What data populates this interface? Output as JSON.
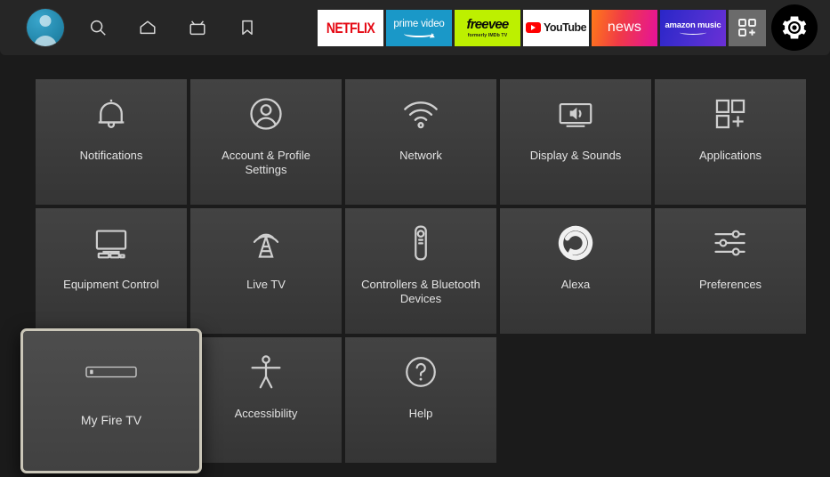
{
  "topbar": {
    "nav": [
      {
        "name": "profile-avatar",
        "icon": "avatar-icon",
        "label": "Profile"
      },
      {
        "name": "search",
        "icon": "search-icon",
        "label": "Search"
      },
      {
        "name": "home",
        "icon": "home-icon",
        "label": "Home"
      },
      {
        "name": "live-tv",
        "icon": "tv-icon",
        "label": "Live TV"
      },
      {
        "name": "watchlist",
        "icon": "bookmark-icon",
        "label": "Watchlist"
      }
    ],
    "apps": [
      {
        "id": "netflix",
        "label": "NETFLIX",
        "sub": "",
        "bg": "#ffffff",
        "fg": "#e50914"
      },
      {
        "id": "prime-video",
        "label": "prime video",
        "sub": "",
        "bg": "#1a98c8",
        "fg": "#ffffff"
      },
      {
        "id": "freevee",
        "label": "freevee",
        "sub": "formerly IMDb TV",
        "bg": "#bdf000",
        "fg": "#0a0a0a"
      },
      {
        "id": "youtube",
        "label": "YouTube",
        "sub": "",
        "bg": "#ffffff",
        "fg": "#181818"
      },
      {
        "id": "news",
        "label": "news",
        "sub": "",
        "bg": "#f03a47",
        "fg": "#ffffff"
      },
      {
        "id": "amazon-music",
        "label": "amazon music",
        "sub": "",
        "bg": "#4b2fd0",
        "fg": "#ffffff"
      }
    ],
    "apps_grid_button": {
      "label": "Apps",
      "icon": "apps-grid-plus-icon"
    },
    "settings_button": {
      "label": "Settings",
      "icon": "gear-icon",
      "focused": true
    }
  },
  "grid": {
    "rows": [
      [
        {
          "label": "Notifications",
          "icon": "bell-icon",
          "focused": false
        },
        {
          "label": "Account & Profile Settings",
          "icon": "account-circle-icon",
          "focused": false
        },
        {
          "label": "Network",
          "icon": "wifi-icon",
          "focused": false
        },
        {
          "label": "Display & Sounds",
          "icon": "display-sound-icon",
          "focused": false
        },
        {
          "label": "Applications",
          "icon": "apps-grid-plus-icon",
          "focused": false
        }
      ],
      [
        {
          "label": "Equipment Control",
          "icon": "equipment-tv-icon",
          "focused": false
        },
        {
          "label": "Live TV",
          "icon": "broadcast-tower-icon",
          "focused": false
        },
        {
          "label": "Controllers & Bluetooth Devices",
          "icon": "remote-control-icon",
          "focused": false
        },
        {
          "label": "Alexa",
          "icon": "alexa-ring-icon",
          "focused": false
        },
        {
          "label": "Preferences",
          "icon": "sliders-icon",
          "focused": false
        }
      ],
      [
        {
          "label": "My Fire TV",
          "icon": "fire-tv-stick-icon",
          "focused": true
        },
        {
          "label": "Accessibility",
          "icon": "accessibility-person-icon",
          "focused": false
        },
        {
          "label": "Help",
          "icon": "question-circle-icon",
          "focused": false
        }
      ]
    ]
  },
  "colors": {
    "page_background": "#1b1b1b",
    "topbar_background": "#262626",
    "tile_background": "#3d3d3d",
    "tile_text": "#e2e2e2",
    "focus_border": "#cbc7b9",
    "avatar_accent": "#2489ad"
  }
}
